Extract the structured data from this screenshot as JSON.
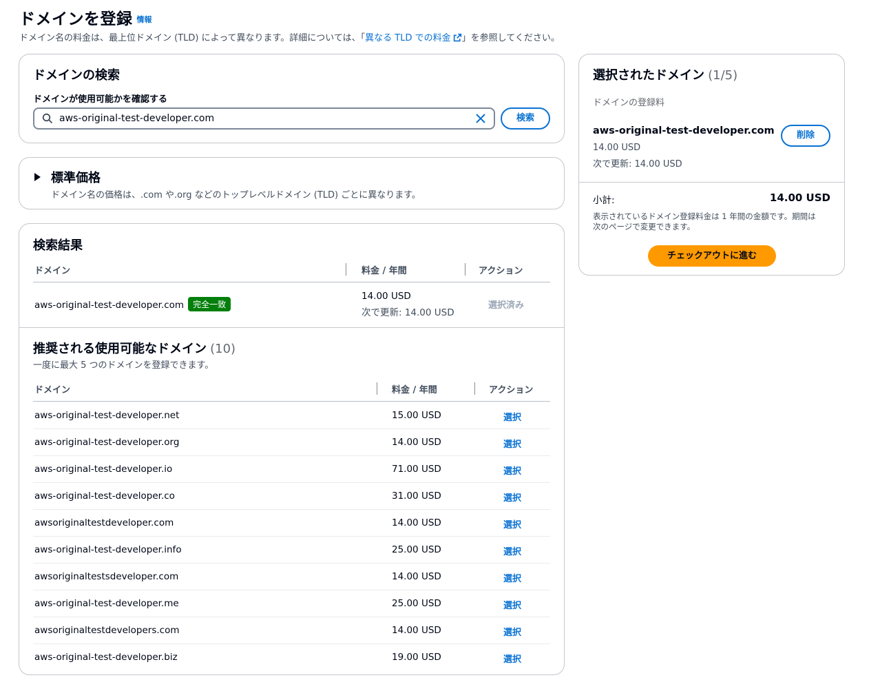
{
  "header": {
    "title": "ドメインを登録",
    "info_link": "情報",
    "desc_before": "ドメイン名の料金は、最上位ドメイン (TLD) によって異なります。詳細については、「",
    "desc_link": "異なる TLD での料金",
    "desc_after": "」を参照してください。"
  },
  "search": {
    "title": "ドメインの検索",
    "label": "ドメインが使用可能かを確認する",
    "value": "aws-original-test-developer.com",
    "button": "検索"
  },
  "pricing": {
    "title": "標準価格",
    "desc": "ドメイン名の価格は、.com や.org などのトップレベルドメイン (TLD) ごとに異なります。"
  },
  "results": {
    "title": "検索結果",
    "col_domain": "ドメイン",
    "col_price": "料金 / 年間",
    "col_action": "アクション",
    "row": {
      "domain": "aws-original-test-developer.com",
      "badge": "完全一致",
      "price": "14.00 USD",
      "renew": "次で更新: 14.00 USD",
      "action": "選択済み"
    }
  },
  "suggested": {
    "title": "推奨される使用可能なドメイン",
    "count": "(10)",
    "desc": "一度に最大 5 つのドメインを登録できます。",
    "col_domain": "ドメイン",
    "col_price": "料金 / 年間",
    "col_action": "アクション",
    "rows": [
      {
        "domain": "aws-original-test-developer.net",
        "price": "15.00 USD",
        "action": "選択"
      },
      {
        "domain": "aws-original-test-developer.org",
        "price": "14.00 USD",
        "action": "選択"
      },
      {
        "domain": "aws-original-test-developer.io",
        "price": "71.00 USD",
        "action": "選択"
      },
      {
        "domain": "aws-original-test-developer.co",
        "price": "31.00 USD",
        "action": "選択"
      },
      {
        "domain": "awsoriginaltestdeveloper.com",
        "price": "14.00 USD",
        "action": "選択"
      },
      {
        "domain": "aws-original-test-developer.info",
        "price": "25.00 USD",
        "action": "選択"
      },
      {
        "domain": "awsoriginaltestsdeveloper.com",
        "price": "14.00 USD",
        "action": "選択"
      },
      {
        "domain": "aws-original-test-developer.me",
        "price": "25.00 USD",
        "action": "選択"
      },
      {
        "domain": "awsoriginaltestdevelopers.com",
        "price": "14.00 USD",
        "action": "選択"
      },
      {
        "domain": "aws-original-test-developer.biz",
        "price": "19.00 USD",
        "action": "選択"
      }
    ]
  },
  "selected": {
    "title": "選択されたドメイン",
    "count": "(1/5)",
    "fee_label": "ドメインの登録料",
    "domain": "aws-original-test-developer.com",
    "price": "14.00 USD",
    "renew": "次で更新: 14.00 USD",
    "remove": "削除",
    "subtotal_label": "小計:",
    "subtotal_value": "14.00 USD",
    "note_line1": "表示されているドメイン登録料金は 1 年間の金額です。期間は",
    "note_line2": "次のページで変更できます。",
    "checkout": "チェックアウトに進む"
  },
  "colors": {
    "accent": "#0972d3",
    "success": "#037f0c",
    "primary_button": "#ff9900"
  }
}
